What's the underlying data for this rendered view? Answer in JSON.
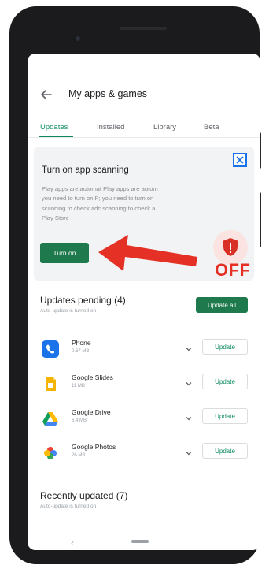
{
  "header": {
    "title": "My apps & games",
    "back_icon": "arrow-left-icon"
  },
  "tabs": [
    {
      "label": "Updates",
      "active": true
    },
    {
      "label": "Installed",
      "active": false
    },
    {
      "label": "Library",
      "active": false
    },
    {
      "label": "Beta",
      "active": false
    }
  ],
  "scan_card": {
    "title": "Turn on app scanning",
    "text": "Play apps are automat Play apps are autom\nyou need to turn on P; you need to turn on\nscanning to check adc scanning to check a\nPlay Store",
    "button_label": "Turn on",
    "close_icon": "close-icon",
    "shield_icon": "shield-alert-icon"
  },
  "annotation": {
    "label": "OFF",
    "color": "#e53125"
  },
  "updates_pending": {
    "title": "Updates pending (4)",
    "subtitle": "Auto-update is turned on",
    "update_all_label": "Update all"
  },
  "apps": [
    {
      "name": "Phone",
      "size": "0.67 MB",
      "icon": "phone-icon",
      "update_label": "Update"
    },
    {
      "name": "Google Slides",
      "size": "11 MB",
      "icon": "google-slides-icon",
      "update_label": "Update"
    },
    {
      "name": "Google Drive",
      "size": "6.4 MB",
      "icon": "google-drive-icon",
      "update_label": "Update"
    },
    {
      "name": "Google Photos",
      "size": "26 MB",
      "icon": "google-photos-icon",
      "update_label": "Update"
    }
  ],
  "recently_updated": {
    "title": "Recently updated (7)",
    "subtitle": "Auto-update is turned on"
  },
  "colors": {
    "accent": "#0e8a5f",
    "button": "#1e7a4d",
    "warning": "#d93025"
  }
}
